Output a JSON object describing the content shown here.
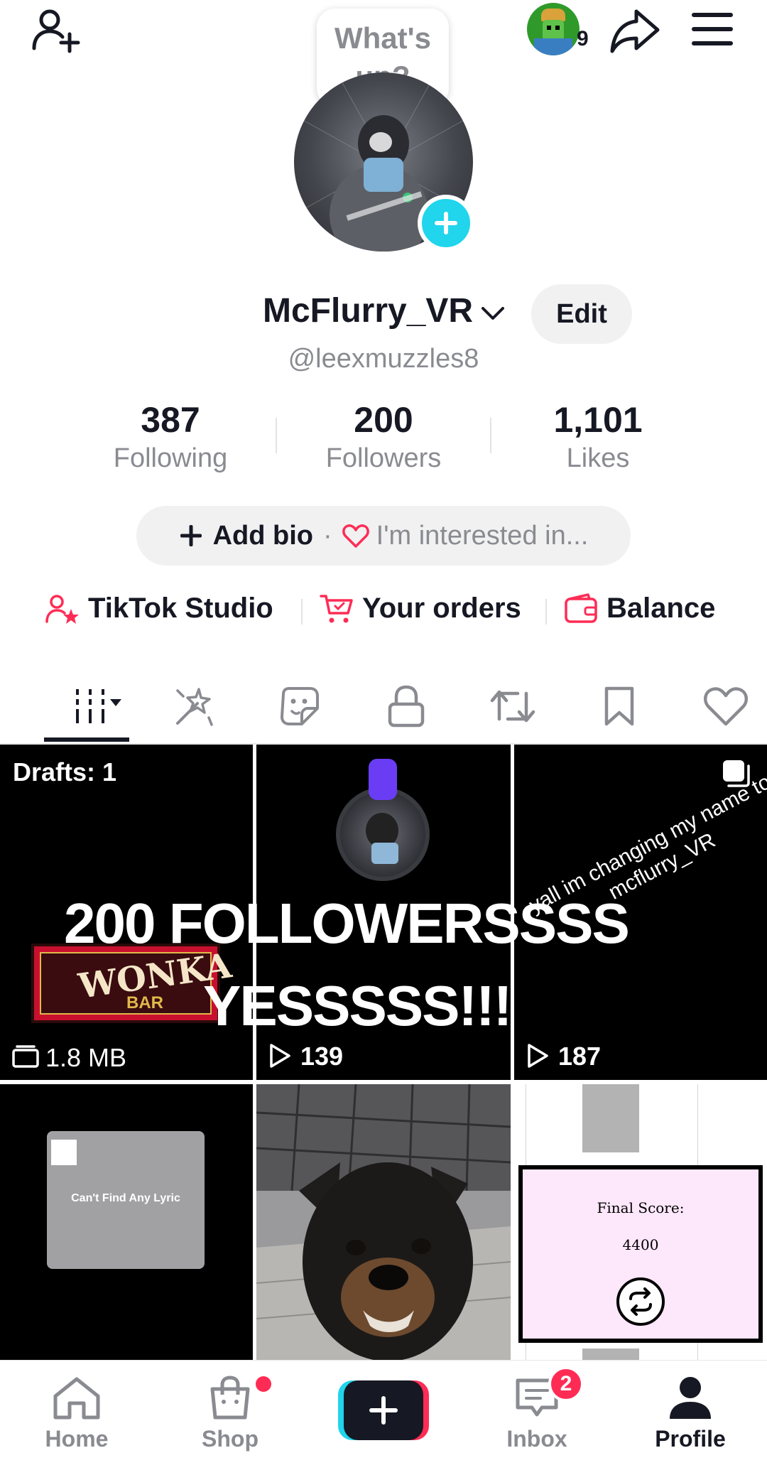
{
  "top_bar": {
    "speech_bubble": "What's up?",
    "notification_count": "9"
  },
  "profile": {
    "display_name": "McFlurry_VR",
    "username": "@leexmuzzles8",
    "edit_label": "Edit"
  },
  "stats": [
    {
      "value": "387",
      "label": "Following"
    },
    {
      "value": "200",
      "label": "Followers"
    },
    {
      "value": "1,101",
      "label": "Likes"
    }
  ],
  "bio": {
    "add_bio": "Add bio",
    "separator": "·",
    "interested": "I'm interested in..."
  },
  "quick_links": {
    "studio": "TikTok Studio",
    "orders": "Your orders",
    "balance": "Balance"
  },
  "content_tabs": [
    "videos",
    "spark",
    "stickers",
    "private",
    "reposts",
    "favorites",
    "liked"
  ],
  "grid": {
    "tile1": {
      "drafts": "Drafts: 1",
      "size": "1.8 MB",
      "wonka_top": "WONKA",
      "wonka_bottom": "BAR"
    },
    "tile2": {
      "views": "139"
    },
    "tile3": {
      "views": "187",
      "overlay_text": "yall im changing my name to mcflurry_VR"
    },
    "overlay_line1": "200 FOLLOWERSSSS",
    "overlay_line2": "YESSSSS!!!",
    "tile4": {
      "caption": "Can't Find Any Lyric"
    },
    "tile6": {
      "score_label": "Final Score:",
      "score_value": "4400"
    }
  },
  "bottom_nav": {
    "home": "Home",
    "shop": "Shop",
    "inbox": "Inbox",
    "inbox_badge": "2",
    "profile": "Profile"
  },
  "colors": {
    "accent_pink": "#fe2c55",
    "accent_cyan": "#20d5ec",
    "text_primary": "#161823",
    "text_secondary": "#8a8b91"
  }
}
